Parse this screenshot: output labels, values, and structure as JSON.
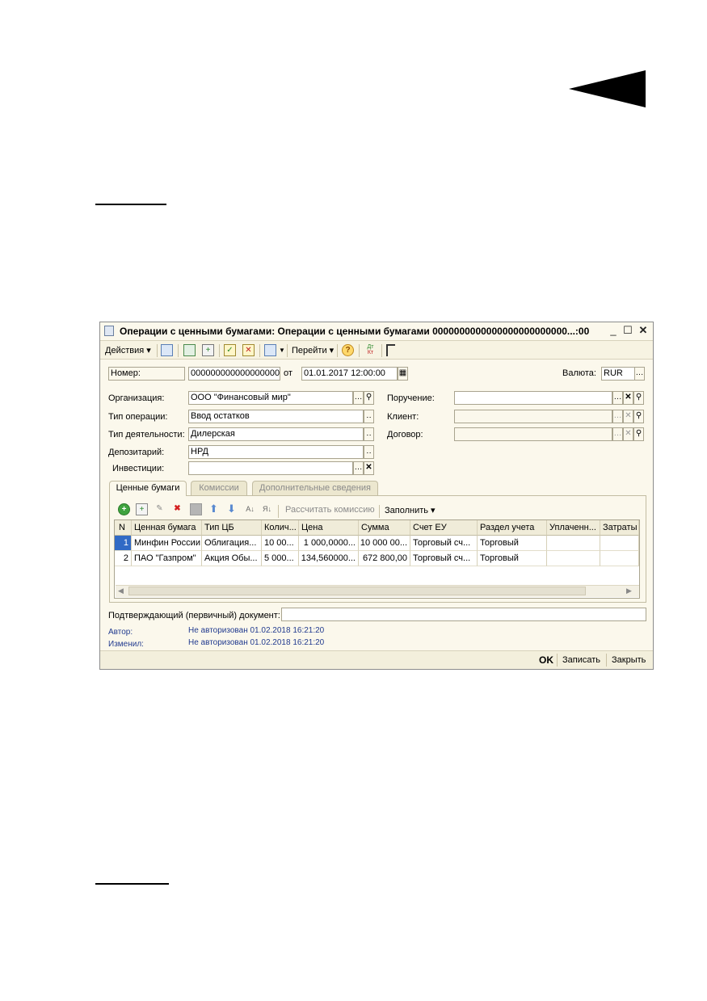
{
  "window": {
    "title": "Операции с ценными бумагами: Операции с ценными бумагами 0000000000000000000000000...:00",
    "min": "_",
    "max": "☐",
    "close": "✕"
  },
  "toolbar": {
    "actions_label": "Действия ▾",
    "goto_label": "Перейти ▾"
  },
  "header": {
    "number_label": "Номер:",
    "number_value": "0000000000000000000000",
    "from_label": "от",
    "date_value": "01.01.2017 12:00:00",
    "currency_label": "Валюта:",
    "currency_value": "RUR"
  },
  "form": {
    "org_label": "Организация:",
    "org_value": "ООО \"Финансовый мир\"",
    "optype_label": "Тип операции:",
    "optype_value": "Ввод остатков",
    "activity_label": "Тип деятельности:",
    "activity_value": "Дилерская",
    "depository_label": "Депозитарий:",
    "depository_value": "НРД",
    "investments_label": "Инвестиции:",
    "investments_value": "",
    "order_label": "Поручение:",
    "client_label": "Клиент:",
    "contract_label": "Договор:"
  },
  "tabs": [
    {
      "label": "Ценные бумаги"
    },
    {
      "label": "Комиссии"
    },
    {
      "label": "Дополнительные сведения"
    }
  ],
  "grid_toolbar": {
    "calc_commission": "Рассчитать комиссию",
    "fill": "Заполнить ▾"
  },
  "grid": {
    "columns": [
      "N",
      "Ценная бумага",
      "Тип ЦБ",
      "Колич...",
      "Цена",
      "Сумма",
      "Счет ЕУ",
      "Раздел учета",
      "Уплаченн...",
      "Затраты"
    ],
    "rows": [
      [
        "1",
        "Минфин России",
        "Облигация...",
        "10 00...",
        "1 000,0000...",
        "10 000 00...",
        "Торговый сч...",
        "Торговый",
        "",
        ""
      ],
      [
        "2",
        "ПАО \"Газпром\"",
        "Акция Обы...",
        "5 000...",
        "134,560000...",
        "672 800,00",
        "Торговый сч...",
        "Торговый",
        "",
        ""
      ]
    ]
  },
  "doc": {
    "confirm_label": "Подтверждающий (первичный) документ:",
    "confirm_value": "",
    "author_label": "Автор:",
    "author_value": "Не авторизован 01.02.2018 16:21:20",
    "changed_label": "Изменил:",
    "changed_value": "Не авторизован 01.02.2018 16:21:20"
  },
  "bottom": {
    "ok": "OK",
    "save": "Записать",
    "close": "Закрыть"
  },
  "colors": {
    "window_bg": "#fbf8ec",
    "selection": "#316ac5",
    "info_text": "#223b8f"
  }
}
